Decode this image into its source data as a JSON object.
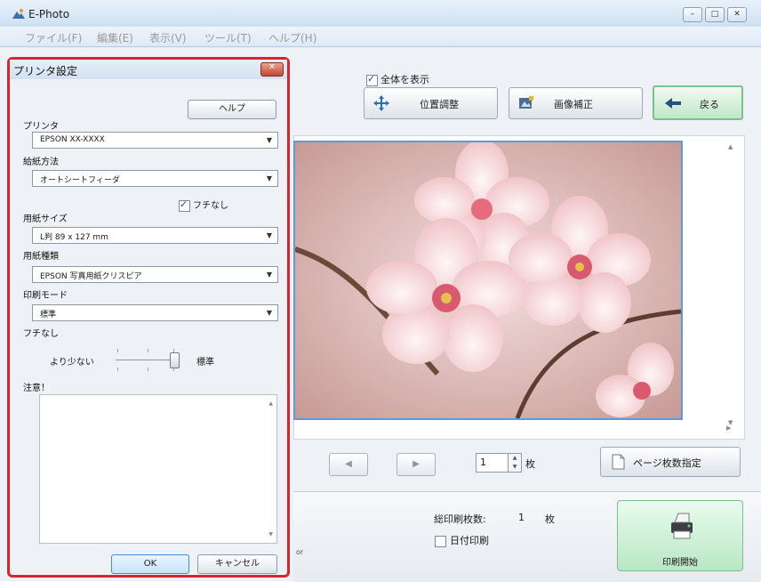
{
  "window": {
    "title": "E-Photo",
    "menu": [
      "ファイル(F)",
      "編集(E)",
      "表示(V)",
      "ツール(T)",
      "ヘルプ(H)"
    ],
    "controls": [
      "–",
      "□",
      "✕"
    ]
  },
  "toolbar": {
    "show_all_label": "全体を表示",
    "show_all_checked": true,
    "position_label": "位置調整",
    "image_correct_label": "画像補正",
    "back_label": "戻る"
  },
  "navigation": {
    "prev": "◀",
    "next": "▶",
    "copies": "1",
    "copies_unit": "枚",
    "page_count_button": "ページ枚数指定"
  },
  "print_panel": {
    "total_label": "総印刷枚数:",
    "total_value": "1",
    "total_unit": "枚",
    "date_print_label": "日付印刷",
    "date_print_checked": false,
    "print_button_label": "印刷開始",
    "stray_text": "or"
  },
  "dialog": {
    "title": "プリンタ設定",
    "help_button": "ヘルプ",
    "printer_label": "プリンタ",
    "printer_value": "EPSON XX-XXXX",
    "feed_label": "給紙方法",
    "feed_value": "オートシートフィーダ",
    "borderless_check_label": "フチなし",
    "borderless_checked": true,
    "paper_size_label": "用紙サイズ",
    "paper_size_value": "L判 89 x 127 mm",
    "paper_type_label": "用紙種類",
    "paper_type_value": "EPSON 写真用紙クリスピア",
    "print_mode_label": "印刷モード",
    "print_mode_value": "標準",
    "borderless_label": "フチなし",
    "slider_min_label": "より少ない",
    "slider_max_label": "標準",
    "slider_level": 1.0,
    "warning_label": "注意！",
    "ok_button": "OK",
    "cancel_button": "キャンセル"
  },
  "colors": {
    "highlight_border": "#d9262c",
    "photo_border": "#5b9bd9",
    "back_button": "#bfe6c7",
    "print_button": "#b9e7c4"
  }
}
